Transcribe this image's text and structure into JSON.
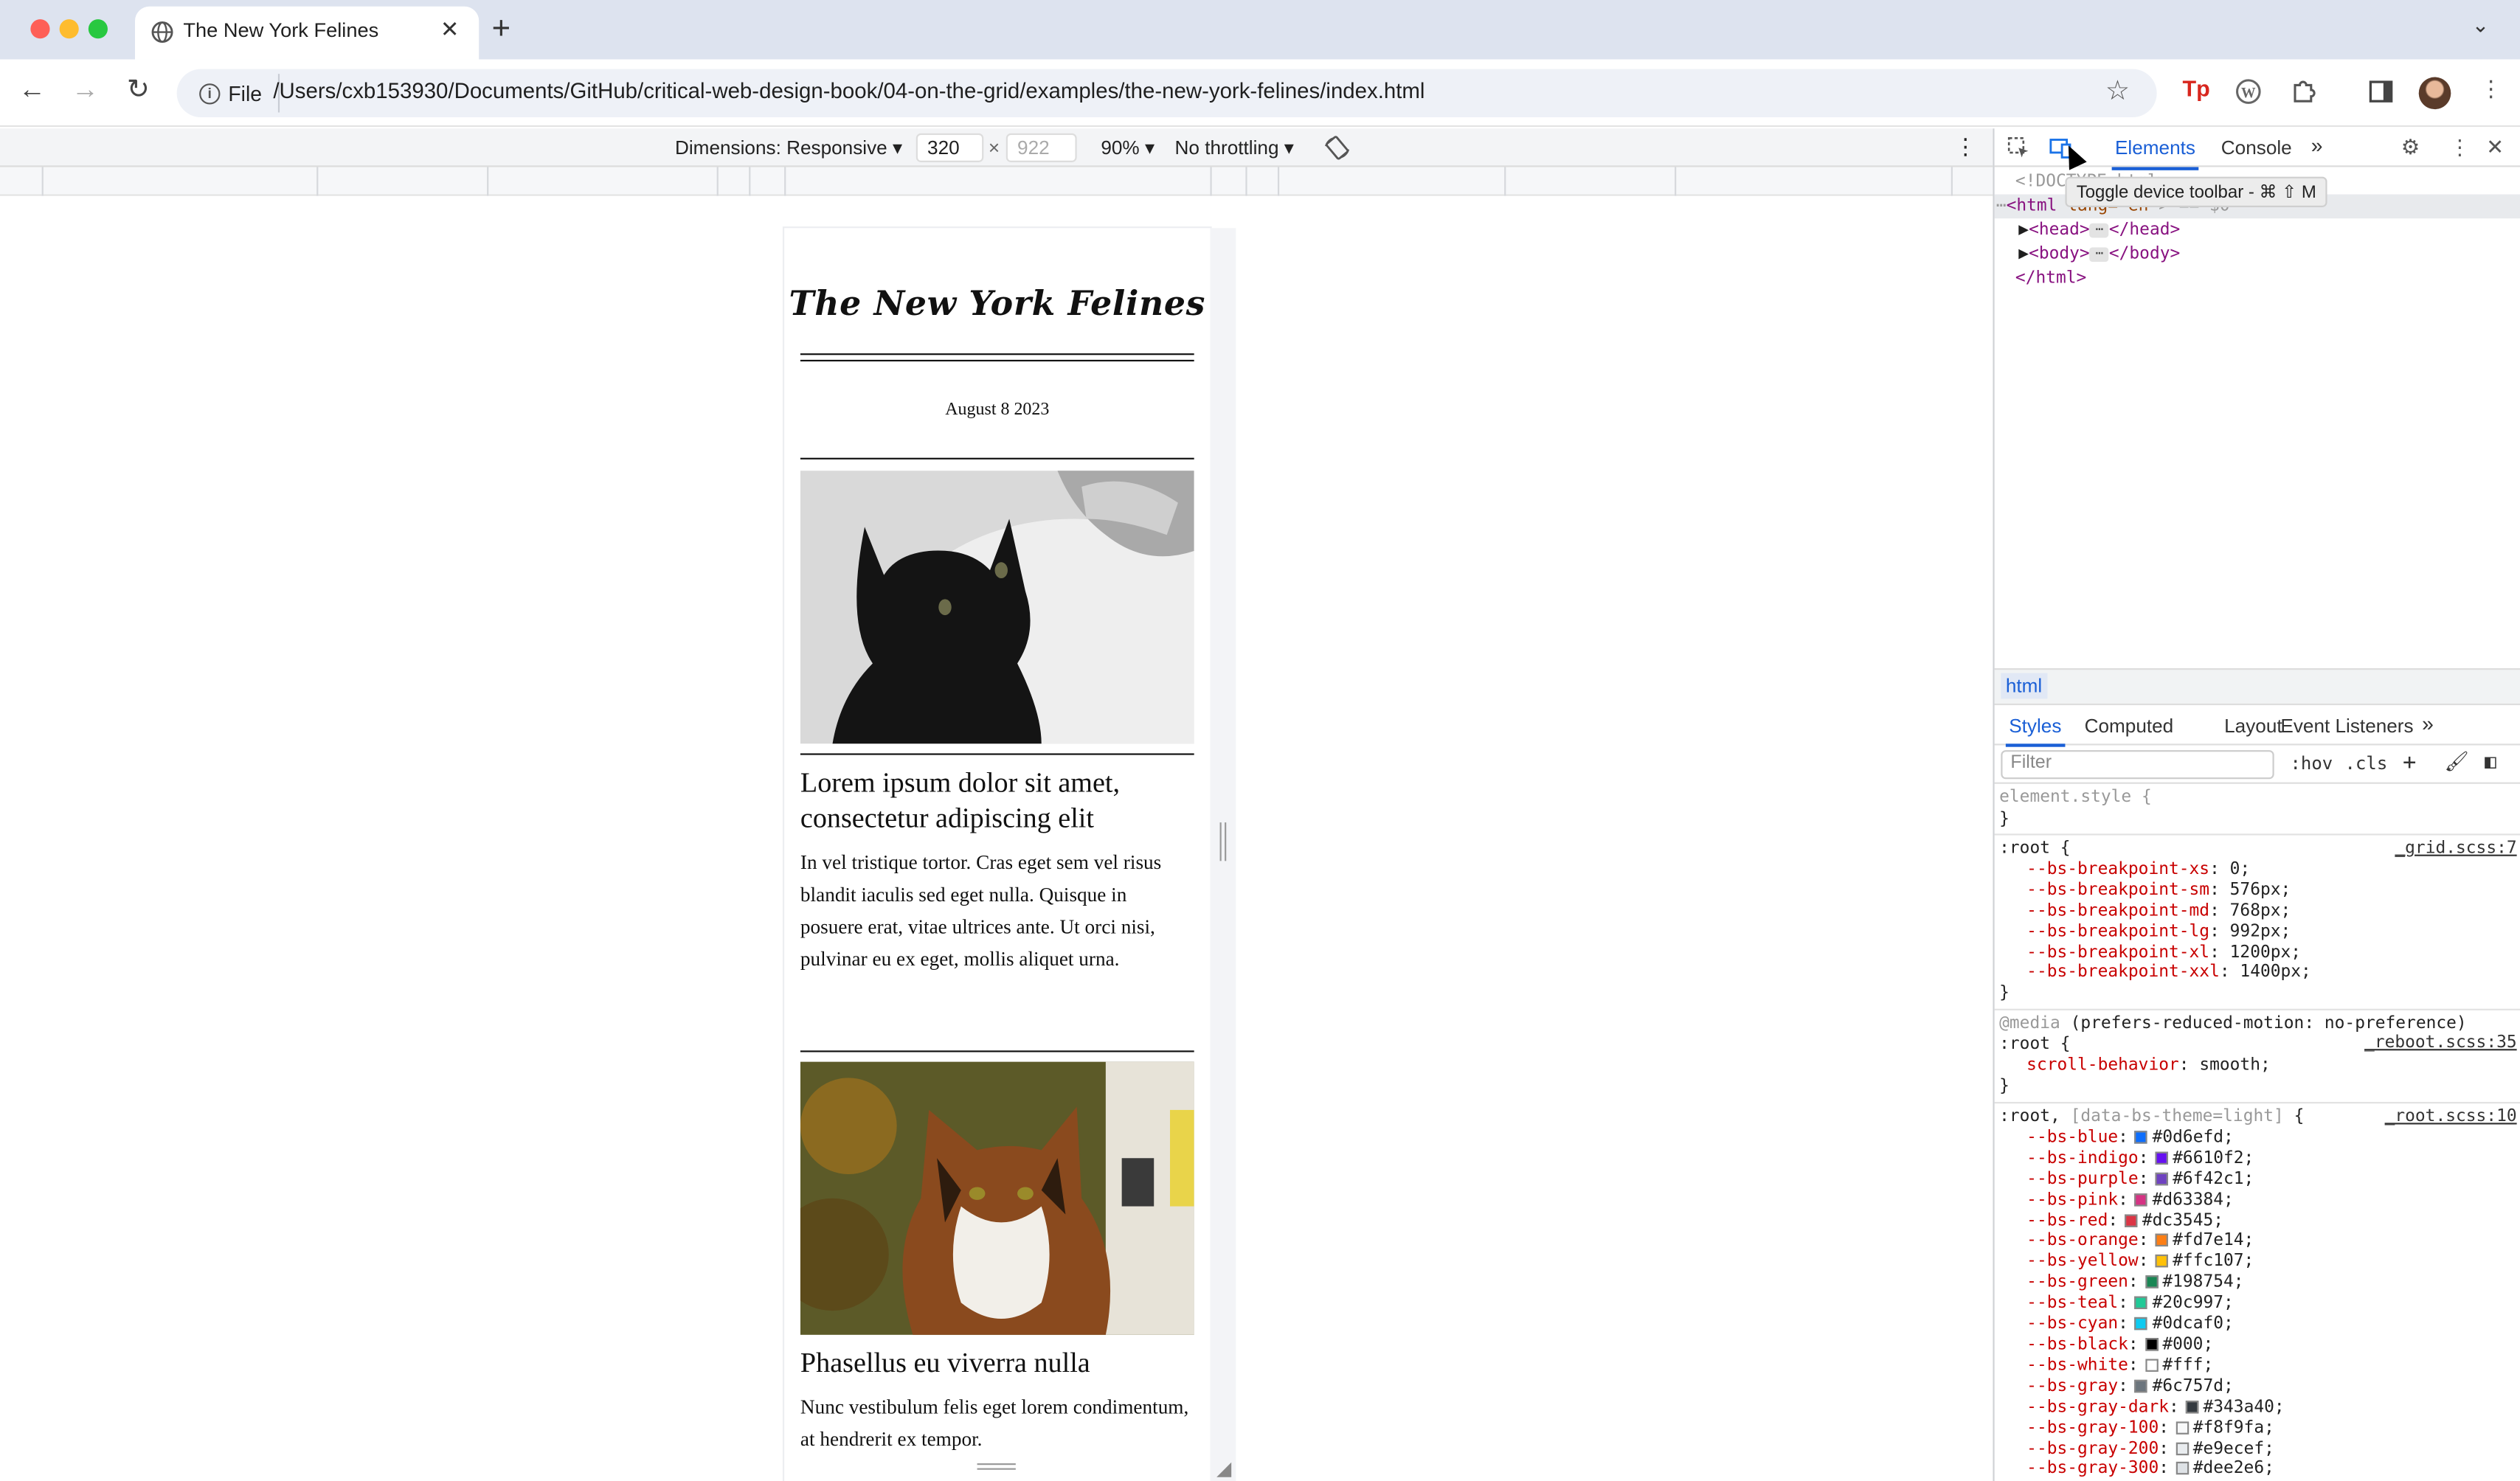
{
  "browser": {
    "tab_title": "The New York Felines",
    "url_chip": "File",
    "url": "/Users/cxb153930/Documents/GitHub/critical-web-design-book/04-on-the-grid/examples/the-new-york-felines/index.html"
  },
  "device_toolbar": {
    "dimensions": "Dimensions: Responsive",
    "width": "320",
    "times": "×",
    "height_placeholder": "922",
    "zoom": "90%",
    "throttling": "No throttling"
  },
  "page": {
    "masthead": "The New York Felines",
    "date": "August 8 2023",
    "articles": [
      {
        "image": "black-cat-photo",
        "headline": "Lorem ipsum dolor sit amet, consectetur adipiscing elit",
        "body": "In vel tristique tortor. Cras eget sem vel risus blandit iaculis sed eget nulla. Quisque in posuere erat, vitae ultrices ante. Ut orci nisi, pulvinar eu ex eget, mollis aliquet urna."
      },
      {
        "image": "calico-cat-photo",
        "headline": "Phasellus eu viverra nulla",
        "body": "Nunc vestibulum felis eget lorem condimentum, at hendrerit ex tempor."
      }
    ]
  },
  "devtools": {
    "tabs": [
      "Elements",
      "Console"
    ],
    "tooltip": "Toggle device toolbar - ⌘ ⇧ M",
    "dom": {
      "doctype": "<!DOCTYPE html>",
      "html_open_tag": "<html",
      "html_attr": "lang=\"en\"",
      "html_suffix": "> == $0",
      "head": "<head>",
      "head_close": "</head>",
      "body": "<body>",
      "body_close": "</body>",
      "html_close": "</html>"
    },
    "breadcrumb": "html",
    "style_tabs": [
      "Styles",
      "Computed",
      "Layout",
      "Event Listeners"
    ],
    "filter_placeholder": "Filter",
    "hov": ":hov",
    "cls": ".cls",
    "rules": {
      "element_style": "element.style {",
      "close": "}",
      "root1_selector": ":root {",
      "root1_source": "_grid.scss:7",
      "root1_props": [
        {
          "name": "--bs-breakpoint-xs",
          "value": "0;"
        },
        {
          "name": "--bs-breakpoint-sm",
          "value": "576px;"
        },
        {
          "name": "--bs-breakpoint-md",
          "value": "768px;"
        },
        {
          "name": "--bs-breakpoint-lg",
          "value": "992px;"
        },
        {
          "name": "--bs-breakpoint-xl",
          "value": "1200px;"
        },
        {
          "name": "--bs-breakpoint-xxl",
          "value": "1400px;"
        }
      ],
      "media_prefix": "@media",
      "media_query": "(prefers-reduced-motion: no-preference)",
      "root2_selector": ":root {",
      "root2_source": "_reboot.scss:35",
      "root2_prop": "scroll-behavior",
      "root2_value": "smooth;",
      "root3_selector": ":root,",
      "root3_selector_extra": "[data-bs-theme=light]",
      "root3_brace": "{",
      "root3_source": "_root.scss:10",
      "colors": [
        {
          "name": "--bs-blue",
          "value": "#0d6efd;",
          "color": "#0d6efd"
        },
        {
          "name": "--bs-indigo",
          "value": "#6610f2;",
          "color": "#6610f2"
        },
        {
          "name": "--bs-purple",
          "value": "#6f42c1;",
          "color": "#6f42c1"
        },
        {
          "name": "--bs-pink",
          "value": "#d63384;",
          "color": "#d63384"
        },
        {
          "name": "--bs-red",
          "value": "#dc3545;",
          "color": "#dc3545"
        },
        {
          "name": "--bs-orange",
          "value": "#fd7e14;",
          "color": "#fd7e14"
        },
        {
          "name": "--bs-yellow",
          "value": "#ffc107;",
          "color": "#ffc107"
        },
        {
          "name": "--bs-green",
          "value": "#198754;",
          "color": "#198754"
        },
        {
          "name": "--bs-teal",
          "value": "#20c997;",
          "color": "#20c997"
        },
        {
          "name": "--bs-cyan",
          "value": "#0dcaf0;",
          "color": "#0dcaf0"
        },
        {
          "name": "--bs-black",
          "value": "#000;",
          "color": "#000000"
        },
        {
          "name": "--bs-white",
          "value": "#fff;",
          "color": "#ffffff"
        },
        {
          "name": "--bs-gray",
          "value": "#6c757d;",
          "color": "#6c757d"
        },
        {
          "name": "--bs-gray-dark",
          "value": "#343a40;",
          "color": "#343a40"
        },
        {
          "name": "--bs-gray-100",
          "value": "#f8f9fa;",
          "color": "#f8f9fa"
        },
        {
          "name": "--bs-gray-200",
          "value": "#e9ecef;",
          "color": "#e9ecef"
        },
        {
          "name": "--bs-gray-300",
          "value": "#dee2e6;",
          "color": "#dee2e6"
        }
      ]
    }
  }
}
